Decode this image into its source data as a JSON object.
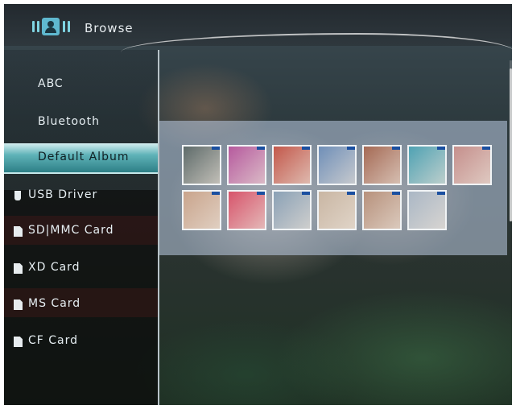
{
  "header": {
    "title": "Browse",
    "icon": "browse-person-icon"
  },
  "sidebar": {
    "items": [
      {
        "label": "ABC",
        "selected": false
      },
      {
        "label": "Bluetooth",
        "selected": false
      },
      {
        "label": "Default Album",
        "selected": true
      },
      {
        "label": "USB Driver",
        "icon": "usb-drive-icon"
      },
      {
        "label": "SD|MMC Card",
        "icon": "memory-card-icon"
      },
      {
        "label": "XD Card",
        "icon": "memory-card-icon"
      },
      {
        "label": "MS Card",
        "icon": "memory-card-icon"
      },
      {
        "label": "CF Card",
        "icon": "memory-card-icon"
      }
    ]
  },
  "thumbnails": {
    "row1": [
      "#5e6b6a",
      "#b65a9e",
      "#c3584b",
      "#6f8fb8",
      "#a56a55",
      "#4fa2b3",
      "#c58f8c"
    ],
    "row2": [
      "#c9a48c",
      "#d7546b",
      "#8aa1b6",
      "#c9b6a3",
      "#b7917c",
      "#aab7c5"
    ]
  },
  "colors": {
    "accent": "#5fb3b8",
    "panel": "#bccde6",
    "card_badge": "#1a4fa0"
  }
}
